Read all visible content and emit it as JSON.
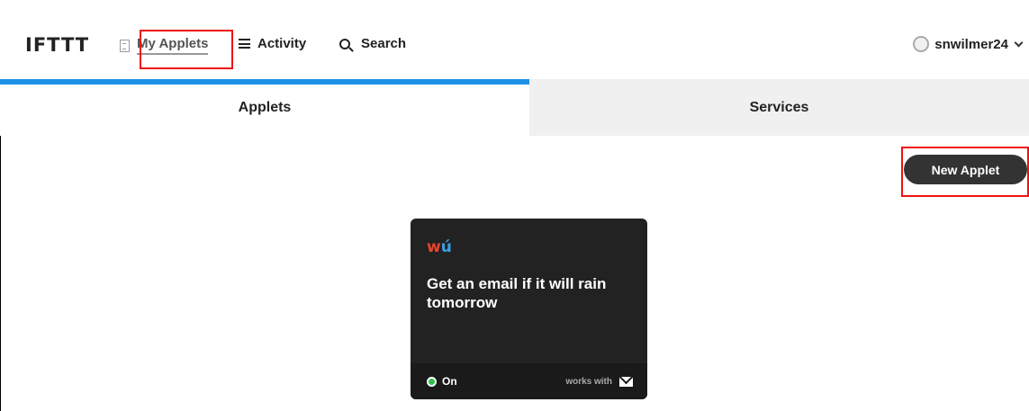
{
  "header": {
    "logo": "IFTTT",
    "nav": {
      "my_applets": "My Applets",
      "activity": "Activity",
      "search": "Search"
    },
    "user": {
      "name": "snwilmer24"
    }
  },
  "tabs": [
    {
      "label": "Applets",
      "active": true
    },
    {
      "label": "Services",
      "active": false
    }
  ],
  "actions": {
    "new_applet": "New Applet"
  },
  "applet_card": {
    "service_logo": "wu",
    "title": "Get an email if it will rain tomorrow",
    "status": "On",
    "works_with": "works with",
    "works_with_icon": "mail-icon"
  },
  "colors": {
    "tab_accent": "#1e90e8",
    "annotation": "#e11111",
    "status_on": "#2fc04a",
    "card_bg": "#222222"
  }
}
